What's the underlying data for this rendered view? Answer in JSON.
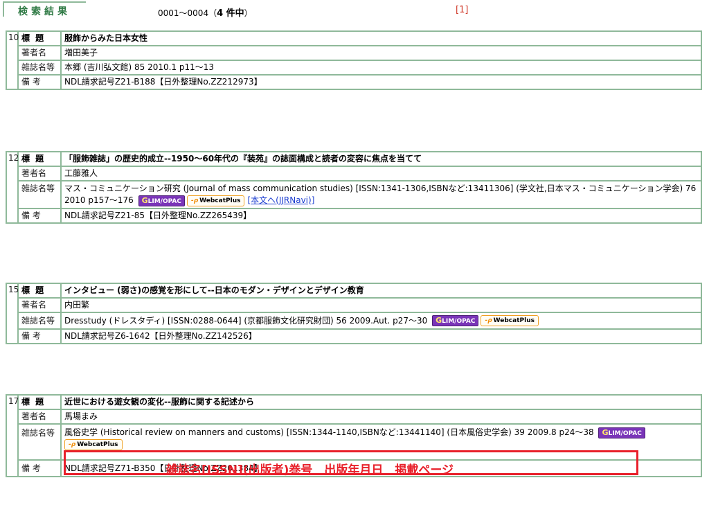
{
  "header": {
    "title": "検索結果",
    "range": "0001～0004（",
    "count": "4 件中",
    "range_end": "）",
    "page_link": "[1]"
  },
  "labels": {
    "title": "標 題",
    "author": "著者名",
    "journal": "雑誌名等",
    "note": "備 考"
  },
  "buttons": {
    "glim_g": "G",
    "glim": "LIM/OPAC",
    "webcat_icon": "-ρ",
    "webcat": "WebcatPlus"
  },
  "records": [
    {
      "num": "10",
      "title": "服飾からみた日本女性",
      "author": "増田美子",
      "journal": "本郷 (吉川弘文館) 85 2010.1 p11～13",
      "note": "NDL請求記号Z21-B188【日外整理No.ZZ212973】"
    },
    {
      "num": "12",
      "title": "「服飾雑誌」の歴史的成立--1950～60年代の『装苑』の誌面構成と読者の変容に焦点を当てて",
      "author": "工藤雅人",
      "journal": "マス・コミュニケーション研究 (Journal of mass communication studies) [ISSN:1341-1306,ISBNなど:13411306] (学文社,日本マス・コミュニケーション学会) 76 2010 p157～176",
      "link": "[本文へ(JJRNavi)]",
      "note": "NDL請求記号Z21-85【日外整理No.ZZ265439】"
    },
    {
      "num": "15",
      "title": "インタビュー (弱さ)の感覚を形にして--日本のモダン・デザインとデザイン教育",
      "author": "内田繁",
      "journal": "Dresstudy (ドレスタディ) [ISSN:0288-0644] (京都服飾文化研究財団) 56 2009.Aut. p27～30",
      "note": "NDL請求記号Z6-1642【日外整理No.ZZ142526】"
    },
    {
      "num": "17",
      "title": "近世における遊女観の変化--服飾に関する記述から",
      "author": "馬場まみ",
      "journal": "風俗史学 (Historical review on manners and customs) [ISSN:1344-1140,ISBNなど:13441140] (日本風俗史学会) 39 2009.8 p24～38",
      "note": "NDL請求記号Z71-B350【日外整理No.ZZ201384】"
    }
  ],
  "annotation": {
    "text": "雑誌名[ISSN](出版者)巻号　出版年月日　掲載ページ",
    "color": "#e8202a"
  }
}
